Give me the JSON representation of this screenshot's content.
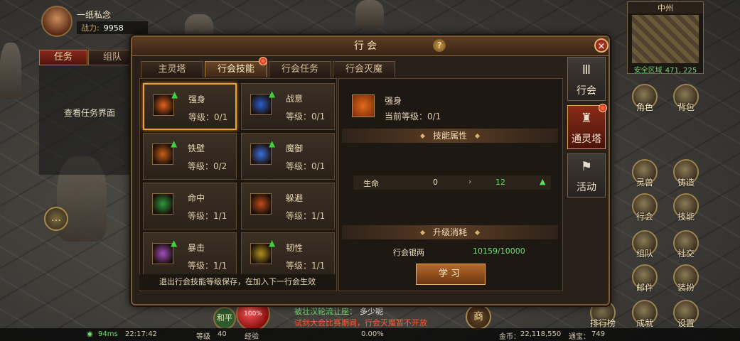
{
  "hud": {
    "player_name": "一纸私念",
    "power_label": "战力:",
    "power_value": "9958",
    "tab_task": "任务",
    "tab_team": "组队",
    "task_view_text": "查看任务界面",
    "hp_percent": "100%",
    "mode": "和平",
    "merchant": "商"
  },
  "minimap": {
    "title": "中州",
    "safe_zone": "安全区域",
    "coords": "471, 225"
  },
  "right_buttons": [
    {
      "label": "角色"
    },
    {
      "label": "背包"
    },
    {
      "label": "灵兽"
    },
    {
      "label": "铸造"
    },
    {
      "label": "行会"
    },
    {
      "label": "技能"
    },
    {
      "label": "组队"
    },
    {
      "label": "社交"
    },
    {
      "label": "邮件"
    },
    {
      "label": "装扮"
    },
    {
      "label": "排行榜"
    },
    {
      "label": "成就"
    },
    {
      "label": "设置"
    }
  ],
  "chat": {
    "line1_prefix": "被壮汉轮流让座：",
    "line1_name": "多少呢",
    "line2": "试剑大会比赛期间，行会灭魔暂不开放"
  },
  "bottom_bar": {
    "ping": "94ms",
    "time": "22:17:42",
    "level_label": "等级",
    "level_value": "40",
    "exp_label": "经验",
    "exp_value": "0.00%",
    "gold_label": "金币：",
    "gold_value": "22,118,550",
    "ingot_label": "通宝：",
    "ingot_value": "749"
  },
  "modal": {
    "title": "行会",
    "help": "?",
    "close": "×",
    "tabs": [
      "主灵塔",
      "行会技能",
      "行会任务",
      "行会灭魔"
    ],
    "active_tab": "行会技能",
    "skills": [
      {
        "name": "强身",
        "level": "等级：0/1",
        "icon": "strength-icon",
        "color": "#e0621a"
      },
      {
        "name": "战意",
        "level": "等级：0/1",
        "icon": "battle-spirit-icon",
        "color": "#2a5fd0"
      },
      {
        "name": "铁壁",
        "level": "等级：0/2",
        "icon": "iron-wall-icon",
        "color": "#c86018"
      },
      {
        "name": "魔御",
        "level": "等级：0/1",
        "icon": "magic-defense-icon",
        "color": "#3a70e0"
      },
      {
        "name": "命中",
        "level": "等级：1/1",
        "icon": "accuracy-icon",
        "color": "#2a9a3a"
      },
      {
        "name": "躲避",
        "level": "等级：1/1",
        "icon": "dodge-icon",
        "color": "#c04a1a"
      },
      {
        "name": "暴击",
        "level": "等级：1/1",
        "icon": "crit-icon",
        "color": "#a050c0"
      },
      {
        "name": "韧性",
        "level": "等级：1/1",
        "icon": "toughness-icon",
        "color": "#b09020"
      }
    ],
    "footer_note": "退出行会技能等级保存，在加入下一行会生效",
    "detail": {
      "name": "强身",
      "current_level": "当前等级：0/1",
      "attr_header": "技能属性",
      "attr_name": "生命",
      "attr_current": "0",
      "attr_next": "12",
      "cost_header": "升级消耗",
      "currency_label": "行会银两",
      "currency_value": "10159/10000",
      "learn_label": "学习"
    },
    "side_tabs": [
      "行会",
      "通灵塔",
      "活动"
    ],
    "active_side_tab": "通灵塔"
  }
}
